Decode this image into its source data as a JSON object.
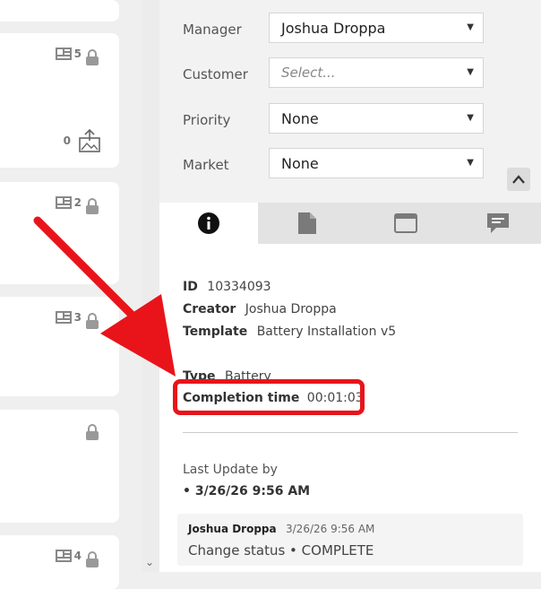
{
  "left_cards": [
    {
      "count": "",
      "show_doc": false
    },
    {
      "count": "5",
      "show_doc": true,
      "upload_count": "0"
    },
    {
      "count": "2",
      "show_doc": true
    },
    {
      "count": "3",
      "show_doc": true
    },
    {
      "count": "",
      "show_doc": false
    },
    {
      "count": "4",
      "show_doc": true
    }
  ],
  "form": {
    "manager": {
      "label": "Manager",
      "value": "Joshua Droppa"
    },
    "customer": {
      "label": "Customer",
      "placeholder": "Select..."
    },
    "priority": {
      "label": "Priority",
      "value": "None"
    },
    "market": {
      "label": "Market",
      "value": "None"
    }
  },
  "tabs": [
    {
      "icon": "info-icon",
      "active": true
    },
    {
      "icon": "document-icon",
      "active": false
    },
    {
      "icon": "window-icon",
      "active": false
    },
    {
      "icon": "comment-icon",
      "active": false
    }
  ],
  "details": {
    "id_key": "ID",
    "id_value": "10334093",
    "creator_key": "Creator",
    "creator_value": "Joshua Droppa",
    "template_key": "Template",
    "template_value": "Battery Installation v5",
    "type_key": "Type",
    "type_value": "Battery",
    "completion_key": "Completion time",
    "completion_value": "00:01:03"
  },
  "last_update": {
    "title": "Last Update by",
    "time": "• 3/26/26 9:56 AM"
  },
  "activity": {
    "user": "Joshua Droppa",
    "timestamp": "3/26/26 9:56 AM",
    "text": "Change status • COMPLETE"
  },
  "colors": {
    "annotation_red": "#e8141a",
    "accent_dark": "#222222"
  }
}
